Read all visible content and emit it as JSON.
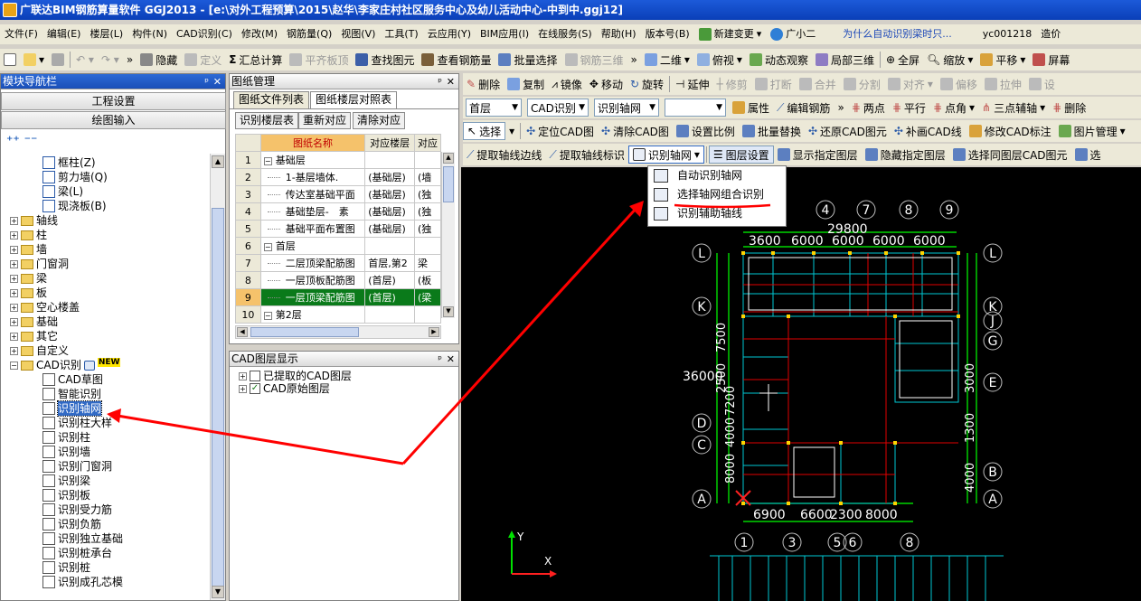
{
  "title": "广联达BIM钢筋算量软件 GGJ2013 - [e:\\对外工程预算\\2015\\赵华\\李家庄村社区服务中心及幼儿活动中心-中到中.ggj12]",
  "menu": [
    "文件(F)",
    "编辑(E)",
    "楼层(L)",
    "构件(N)",
    "CAD识别(C)",
    "修改(M)",
    "钢筋量(Q)",
    "视图(V)",
    "工具(T)",
    "云应用(Y)",
    "BIM应用(I)",
    "在线服务(S)",
    "帮助(H)",
    "版本号(B)"
  ],
  "menu_right": {
    "new_change": "新建变更",
    "assistant": "广小二",
    "question": "为什么自动识别梁时只...",
    "user": "yc001218",
    "more": "造价"
  },
  "toolbar1": {
    "hide": "隐藏",
    "define": "定义",
    "sum": "汇总计算",
    "flat_slab": "平齐板顶",
    "find": "查找图元",
    "view_rebar": "查看钢筋量",
    "batch_select": "批量选择",
    "rebar3d": "钢筋三维",
    "view_mode": "二维",
    "top_view": "俯视",
    "dyn_view": "动态观察",
    "local3d": "局部三维",
    "fullscreen": "全屏",
    "zoom": "缩放",
    "pan": "平移",
    "screen": "屏幕"
  },
  "toolbar2": {
    "delete": "删除",
    "copy": "复制",
    "mirror": "镜像",
    "move": "移动",
    "rotate": "旋转",
    "extend": "延伸",
    "trim": "修剪",
    "break": "打断",
    "merge": "合并",
    "split": "分割",
    "align": "对齐",
    "offset": "偏移",
    "stretch": "拉伸",
    "set": "设"
  },
  "toolbar3": {
    "floor": "首层",
    "cad": "CAD识别",
    "axis": "识别轴网",
    "attr": "属性",
    "edit_rebar": "编辑钢筋",
    "two_point": "两点",
    "parallel": "平行",
    "point_angle": "点角",
    "three_point": "三点辅轴",
    "delete_aux": "删除"
  },
  "toolbar4": {
    "select": "选择",
    "locate": "定位CAD图",
    "clear": "清除CAD图",
    "scale": "设置比例",
    "batch_replace": "批量替换",
    "restore": "还原CAD图元",
    "paint": "补画CAD线",
    "modify": "修改CAD标注",
    "pic_manage": "图片管理"
  },
  "toolbar5": {
    "extract_line": "提取轴线边线",
    "extract_label": "提取轴线标识",
    "recognize": "识别轴网",
    "layer_set": "图层设置",
    "show_layer": "显示指定图层",
    "hide_layer": "隐藏指定图层",
    "select_same": "选择同图层CAD图元",
    "sel": "选"
  },
  "axis_menu": {
    "items": [
      "自动识别轴网",
      "选择轴网组合识别",
      "识别辅助轴线"
    ]
  },
  "nav": {
    "header": "模块导航栏",
    "project_settings": "工程设置",
    "drawing_input": "绘图输入",
    "items": [
      {
        "label": "框柱(Z)"
      },
      {
        "label": "剪力墙(Q)"
      },
      {
        "label": "梁(L)"
      },
      {
        "label": "现浇板(B)"
      },
      {
        "label": "轴线"
      },
      {
        "label": "柱"
      },
      {
        "label": "墙"
      },
      {
        "label": "门窗洞"
      },
      {
        "label": "梁"
      },
      {
        "label": "板"
      },
      {
        "label": "空心楼盖"
      },
      {
        "label": "基础"
      },
      {
        "label": "其它"
      },
      {
        "label": "自定义"
      },
      {
        "label": "CAD识别",
        "badge": "NEW"
      },
      {
        "label": "CAD草图"
      },
      {
        "label": "智能识别"
      },
      {
        "label": "识别轴网"
      },
      {
        "label": "识别柱大样"
      },
      {
        "label": "识别柱"
      },
      {
        "label": "识别墙"
      },
      {
        "label": "识别门窗洞"
      },
      {
        "label": "识别梁"
      },
      {
        "label": "识别板"
      },
      {
        "label": "识别受力筋"
      },
      {
        "label": "识别负筋"
      },
      {
        "label": "识别独立基础"
      },
      {
        "label": "识别桩承台"
      },
      {
        "label": "识别桩"
      },
      {
        "label": "识别成孔芯模"
      }
    ]
  },
  "drawing_mgmt": {
    "header": "图纸管理",
    "tabs": [
      "图纸文件列表",
      "图纸楼层对照表"
    ],
    "buttons": [
      "识别楼层表",
      "重新对应",
      "清除对应"
    ],
    "columns": [
      "图纸名称",
      "对应楼层",
      "对应"
    ],
    "rows": [
      {
        "n": "1",
        "name": "基础层",
        "floor": "",
        "c": "",
        "group": true
      },
      {
        "n": "2",
        "name": "1-基层墙体.",
        "floor": "(基础层)",
        "c": "(墙"
      },
      {
        "n": "3",
        "name": "传达室基础平面",
        "floor": "(基础层)",
        "c": "(独"
      },
      {
        "n": "4",
        "name": "基础垫层-　素",
        "floor": "(基础层)",
        "c": "(独"
      },
      {
        "n": "5",
        "name": "基础平面布置图",
        "floor": "(基础层)",
        "c": "(独"
      },
      {
        "n": "6",
        "name": "首层",
        "floor": "",
        "c": "",
        "group": true
      },
      {
        "n": "7",
        "name": "二层顶梁配筋图",
        "floor": "首层,第2",
        "c": "梁"
      },
      {
        "n": "8",
        "name": "一层顶板配筋图",
        "floor": "(首层)",
        "c": "(板"
      },
      {
        "n": "9",
        "name": "一层顶梁配筋图",
        "floor": "(首层)",
        "c": "(梁"
      },
      {
        "n": "10",
        "name": "第2层",
        "floor": "",
        "c": "",
        "group": true
      }
    ]
  },
  "cad_layers": {
    "header": "CAD图层显示",
    "items": [
      "已提取的CAD图层",
      "CAD原始图层"
    ]
  },
  "cad": {
    "top_axes": [
      "4",
      "7",
      "8",
      "9"
    ],
    "bottom_axes": [
      "1",
      "3",
      "5",
      "6",
      "8"
    ],
    "left_axes": [
      "L",
      "K",
      "D",
      "C",
      "A"
    ],
    "right_axes": [
      "L",
      "K",
      "J",
      "G",
      "E",
      "B",
      "A"
    ],
    "dims_top": "29800",
    "dims_top_parts": [
      "3600",
      "6000",
      "6000",
      "6000",
      "6000"
    ],
    "dims_bottom": "6900",
    "dims_bottom2": "6600",
    "dims_bottom3": "2300",
    "dims_bottom4": "8000",
    "dims_left": "36000",
    "left_dims": [
      "2500",
      "7500",
      "4000",
      "7200",
      "8000"
    ],
    "right_dims": [
      "3000",
      "1300",
      "4000"
    ],
    "ucs_y": "Y",
    "ucs_x": "X"
  }
}
